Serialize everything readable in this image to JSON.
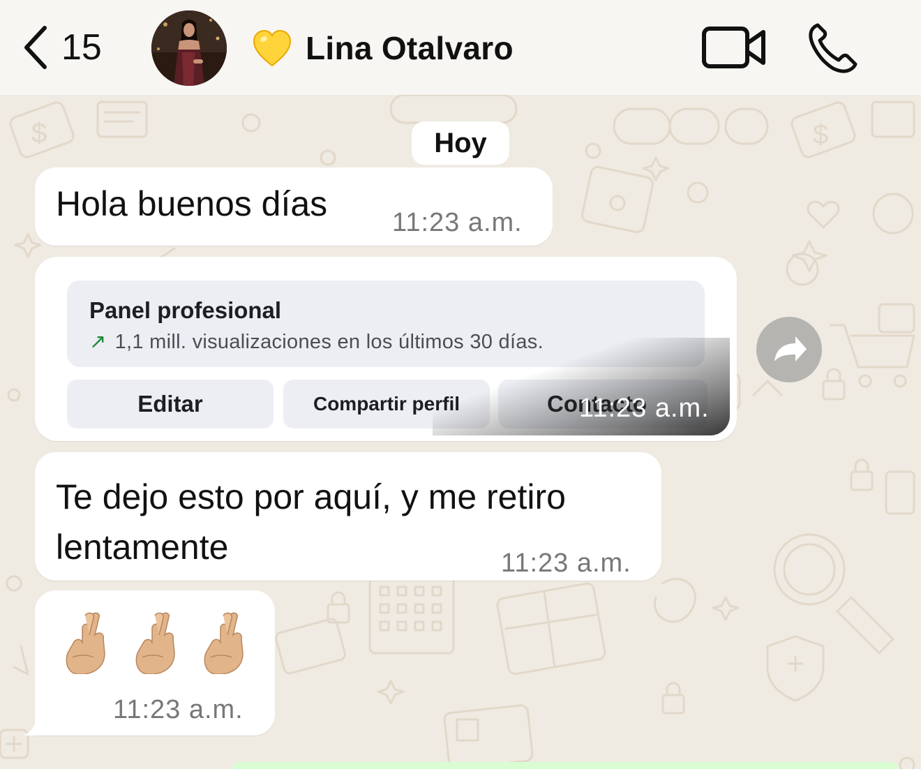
{
  "header": {
    "back_count": "15",
    "contact_name": "Lina Otalvaro",
    "heart_emoji": "yellow-heart",
    "icons": [
      "chevron-left-icon",
      "video-camera-icon",
      "phone-icon"
    ]
  },
  "date_chip": "Hoy",
  "messages": [
    {
      "text": "Hola buenos días",
      "time": "11:23 a.m."
    },
    {
      "card": {
        "title": "Panel profesional",
        "stat": "1,1 mill. visualizaciones en los últimos 30 días.",
        "buttons": [
          "Editar",
          "Compartir perfil",
          "Contacto"
        ]
      },
      "time": "11:23 a.m."
    },
    {
      "text_line1": "Te dejo esto por aquí, y me retiro",
      "text_line2": "lentamente",
      "time": "11:23 a.m."
    },
    {
      "emoji": "crossed-fingers-light-skin",
      "emoji_count": 3,
      "time": "11:23 a.m."
    }
  ],
  "colors": {
    "header_bg": "#f7f6f2",
    "wallpaper_bg": "#efeae2",
    "wallpaper_doodle": "#e3d9cb",
    "bubble_in": "#ffffff",
    "bubble_out": "#d9fdd3",
    "timestamp": "#777777",
    "card_bg": "#eceef3",
    "stat_arrow": "#1e8a3c"
  }
}
